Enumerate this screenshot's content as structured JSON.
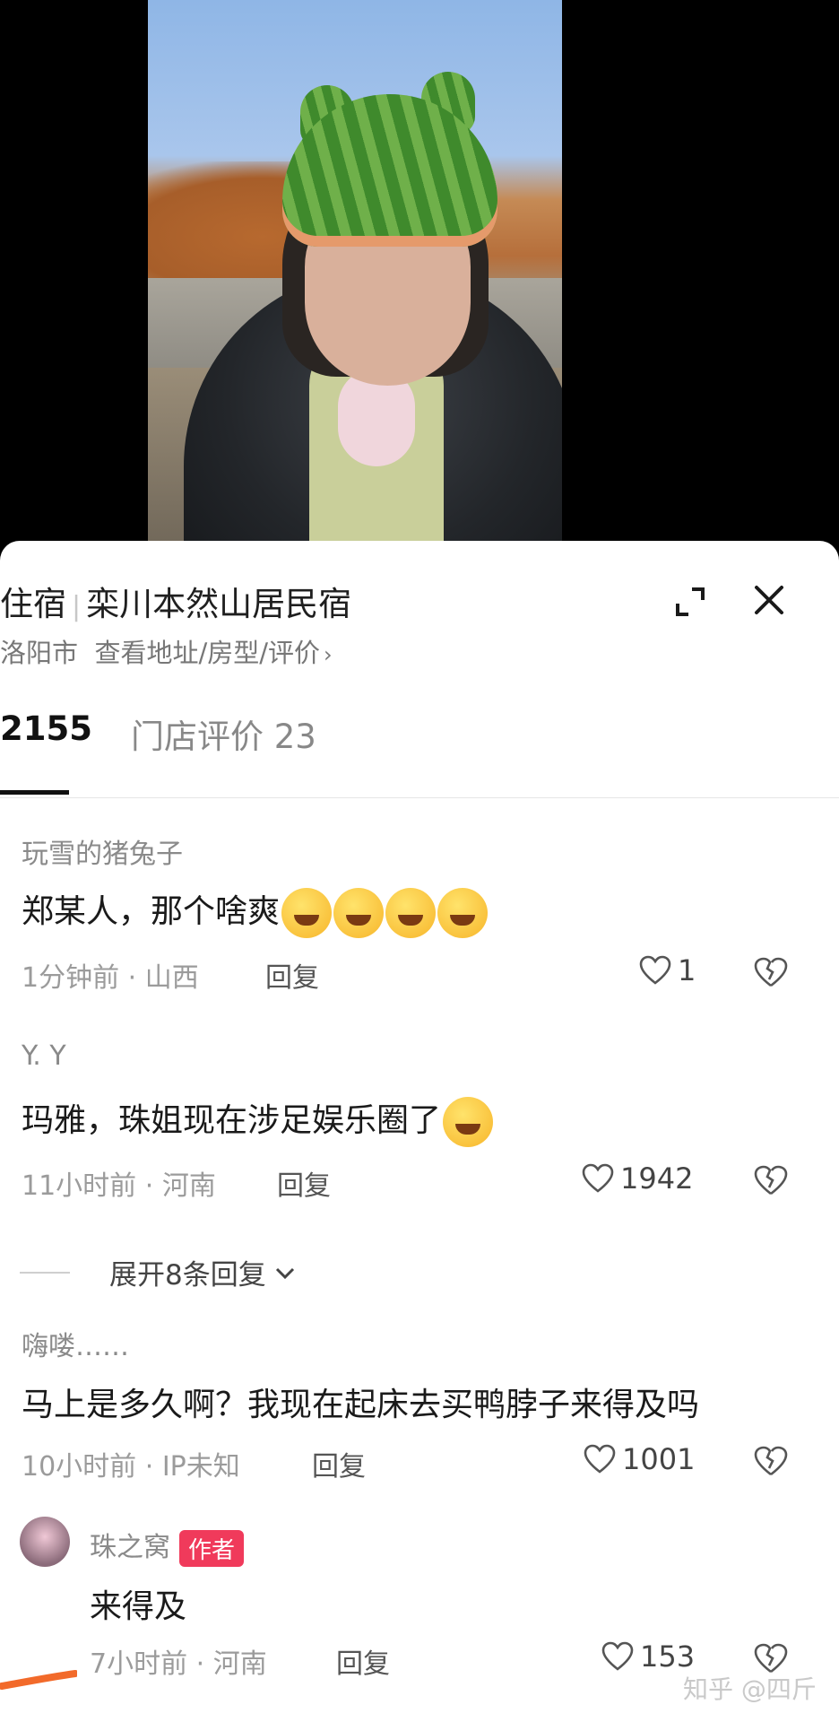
{
  "header": {
    "category": "住宿",
    "place_name": "栾川本然山居民宿",
    "city": "洛阳市",
    "details_link": "查看地址/房型/评价"
  },
  "tabs": [
    {
      "label": "2155",
      "active": true
    },
    {
      "label": "门店评价 23",
      "active": false
    }
  ],
  "comments": [
    {
      "user": "玩雪的猪兔子",
      "text": "郑某人，那个啥爽",
      "emoji_count": 4,
      "time": "1分钟前",
      "location": "山西",
      "reply": "回复",
      "likes": "1"
    },
    {
      "user": "Y. Y",
      "text": "玛雅，珠姐现在涉足娱乐圈了",
      "emoji_count": 1,
      "time": "11小时前",
      "location": "河南",
      "reply": "回复",
      "likes": "1942"
    },
    {
      "user": "嗨喽……",
      "text": "马上是多久啊？我现在起床去买鸭脖子来得及吗",
      "time": "10小时前",
      "location": "IP未知",
      "reply": "回复",
      "likes": "1001"
    }
  ],
  "expand_replies": "展开8条回复",
  "author_reply": {
    "user": "珠之窝",
    "badge": "作者",
    "text": "来得及",
    "time": "7小时前",
    "location": "河南",
    "reply": "回复",
    "likes": "153"
  },
  "meta_separator": "·",
  "watermark": "知乎 @四斤",
  "colors": {
    "accent_badge": "#f03a5b",
    "text_primary": "#1a1a1a",
    "text_secondary": "#9b9b9b"
  }
}
